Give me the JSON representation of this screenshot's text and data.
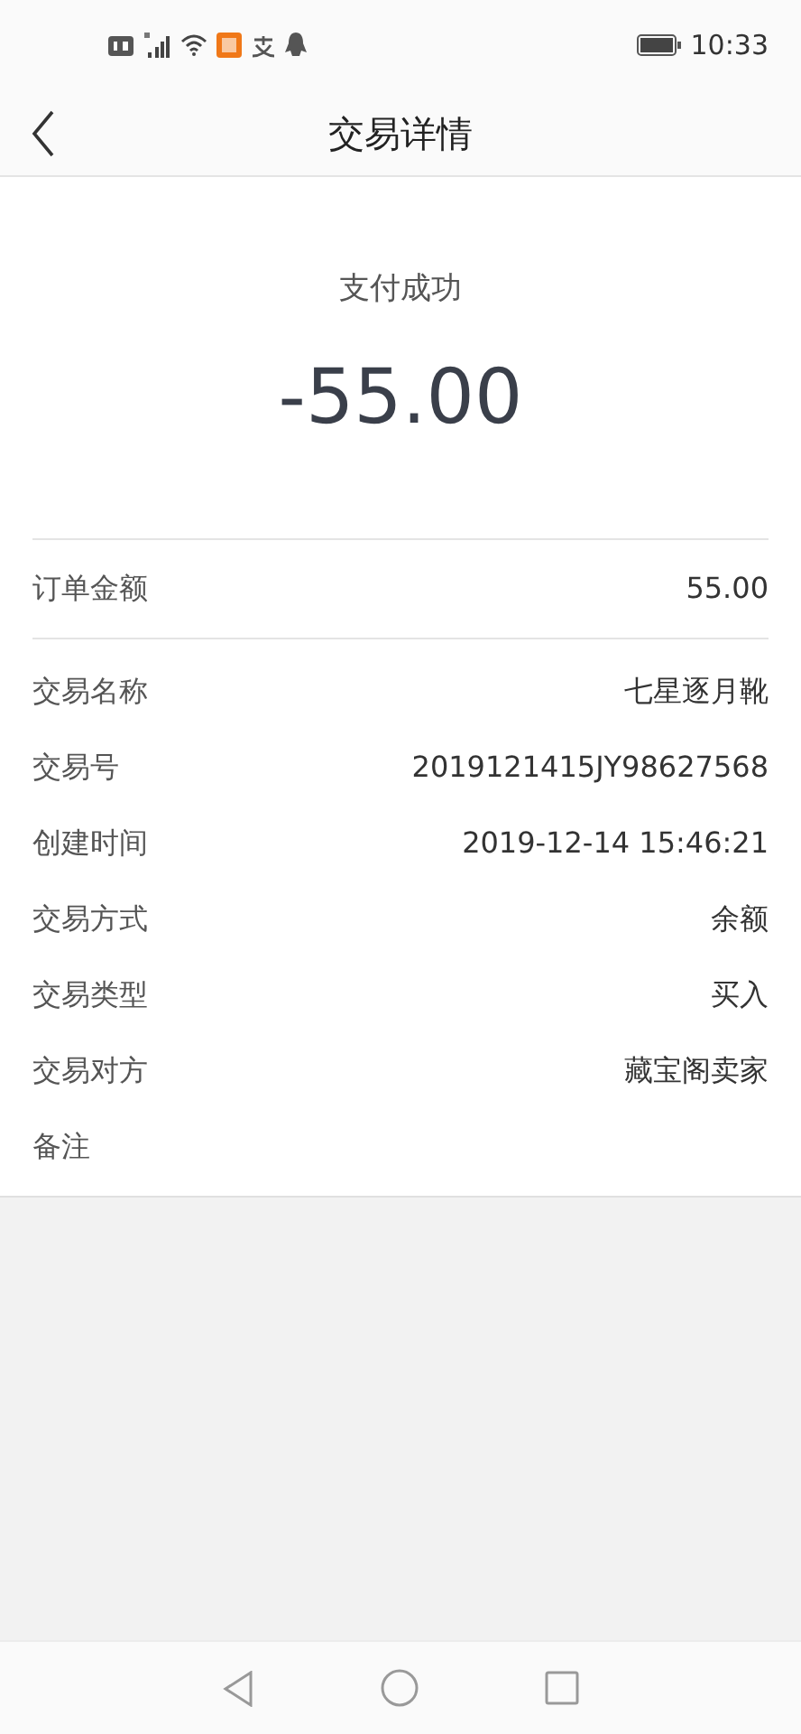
{
  "status_bar": {
    "time": "10:33"
  },
  "header": {
    "title": "交易详情"
  },
  "result": {
    "status": "支付成功",
    "amount": "-55.00"
  },
  "summary_rows": [
    {
      "label": "订单金额",
      "value": "55.00"
    }
  ],
  "detail_rows": [
    {
      "label": "交易名称",
      "value": "七星逐月靴"
    },
    {
      "label": "交易号",
      "value": "2019121415JY98627568"
    },
    {
      "label": "创建时间",
      "value": "2019-12-14 15:46:21"
    },
    {
      "label": "交易方式",
      "value": "余额"
    },
    {
      "label": "交易类型",
      "value": "买入"
    },
    {
      "label": "交易对方",
      "value": "藏宝阁卖家"
    },
    {
      "label": "备注"
    }
  ]
}
